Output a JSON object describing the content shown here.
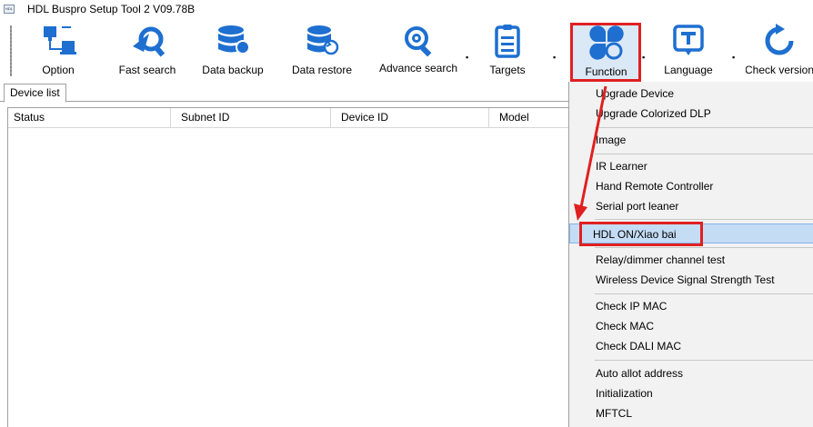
{
  "window": {
    "title": "HDL Buspro Setup Tool 2 V09.78B",
    "logo_text": "HDL"
  },
  "toolbar": {
    "option": "Option",
    "fast_search": "Fast search",
    "data_backup": "Data backup",
    "data_restore": "Data restore",
    "advance_search": "Advance search",
    "targets": "Targets",
    "function": "Function",
    "language": "Language",
    "check_version": "Check version"
  },
  "tabs": {
    "device_list": "Device list"
  },
  "grid": {
    "columns": [
      "Status",
      "Subnet ID",
      "Device ID",
      "Model"
    ]
  },
  "function_menu": {
    "items": [
      "Upgrade Device",
      "Upgrade Colorized DLP",
      "Image",
      "IR Learner",
      "Hand Remote Controller",
      "Serial port leaner",
      "HDL ON/Xiao bai",
      "Relay/dimmer channel test",
      "Wireless Device Signal Strength Test",
      "Check IP MAC",
      "Check MAC",
      "Check DALI MAC",
      "Auto allot address",
      "Initialization",
      "MFTCL"
    ],
    "selected": "HDL ON/Xiao bai"
  },
  "colors": {
    "icon_blue": "#1e6fd0",
    "highlight_red": "#e02020",
    "menu_bg": "#f2f2f2",
    "selected_bg": "#c5dcf5"
  },
  "icons": [
    "network-icon",
    "airplane-search-icon",
    "database-icon",
    "database-restore-icon",
    "magnifier-gear-icon",
    "checklist-icon",
    "clover-icon",
    "text-t-icon",
    "refresh-icon"
  ]
}
